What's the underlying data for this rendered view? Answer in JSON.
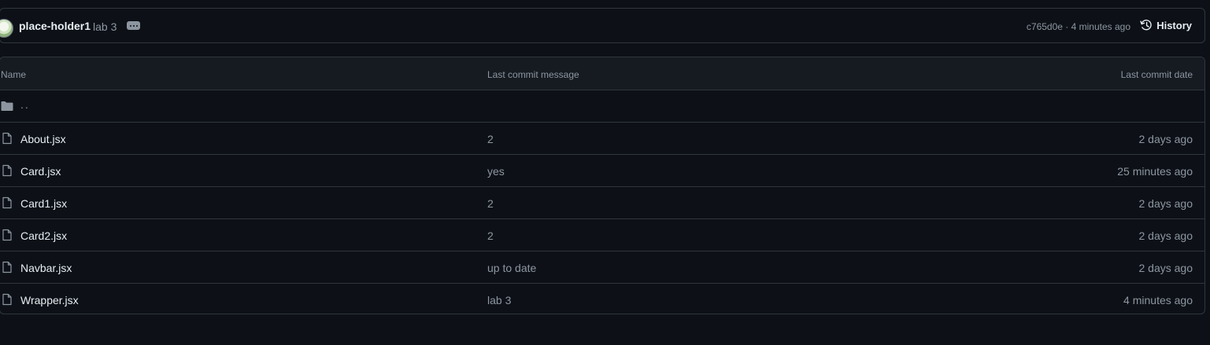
{
  "commit": {
    "author": "place-holder1",
    "message": "lab 3",
    "sha": "c765d0e",
    "separator": " · ",
    "age": "4 minutes ago",
    "history_label": "History",
    "icons": {
      "avatar": "user-avatar",
      "ellipsis": "kebab-horizontal-icon",
      "history": "history-icon"
    }
  },
  "table": {
    "headers": {
      "name": "Name",
      "message": "Last commit message",
      "date": "Last commit date"
    },
    "parent": {
      "label": "..",
      "icon": "folder-icon"
    },
    "rows": [
      {
        "name": "About.jsx",
        "message": "2",
        "date": "2 days ago",
        "icon": "file-icon"
      },
      {
        "name": "Card.jsx",
        "message": "yes",
        "date": "25 minutes ago",
        "icon": "file-icon"
      },
      {
        "name": "Card1.jsx",
        "message": "2",
        "date": "2 days ago",
        "icon": "file-icon"
      },
      {
        "name": "Card2.jsx",
        "message": "2",
        "date": "2 days ago",
        "icon": "file-icon"
      },
      {
        "name": "Navbar.jsx",
        "message": "up to date",
        "date": "2 days ago",
        "icon": "file-icon"
      },
      {
        "name": "Wrapper.jsx",
        "message": "lab 3",
        "date": "4 minutes ago",
        "icon": "file-icon"
      }
    ]
  },
  "colors": {
    "background": "#0d1117",
    "header_bg": "#161b22",
    "border": "#30363d",
    "text_primary": "#e6edf3",
    "text_muted": "#8d96a0"
  }
}
